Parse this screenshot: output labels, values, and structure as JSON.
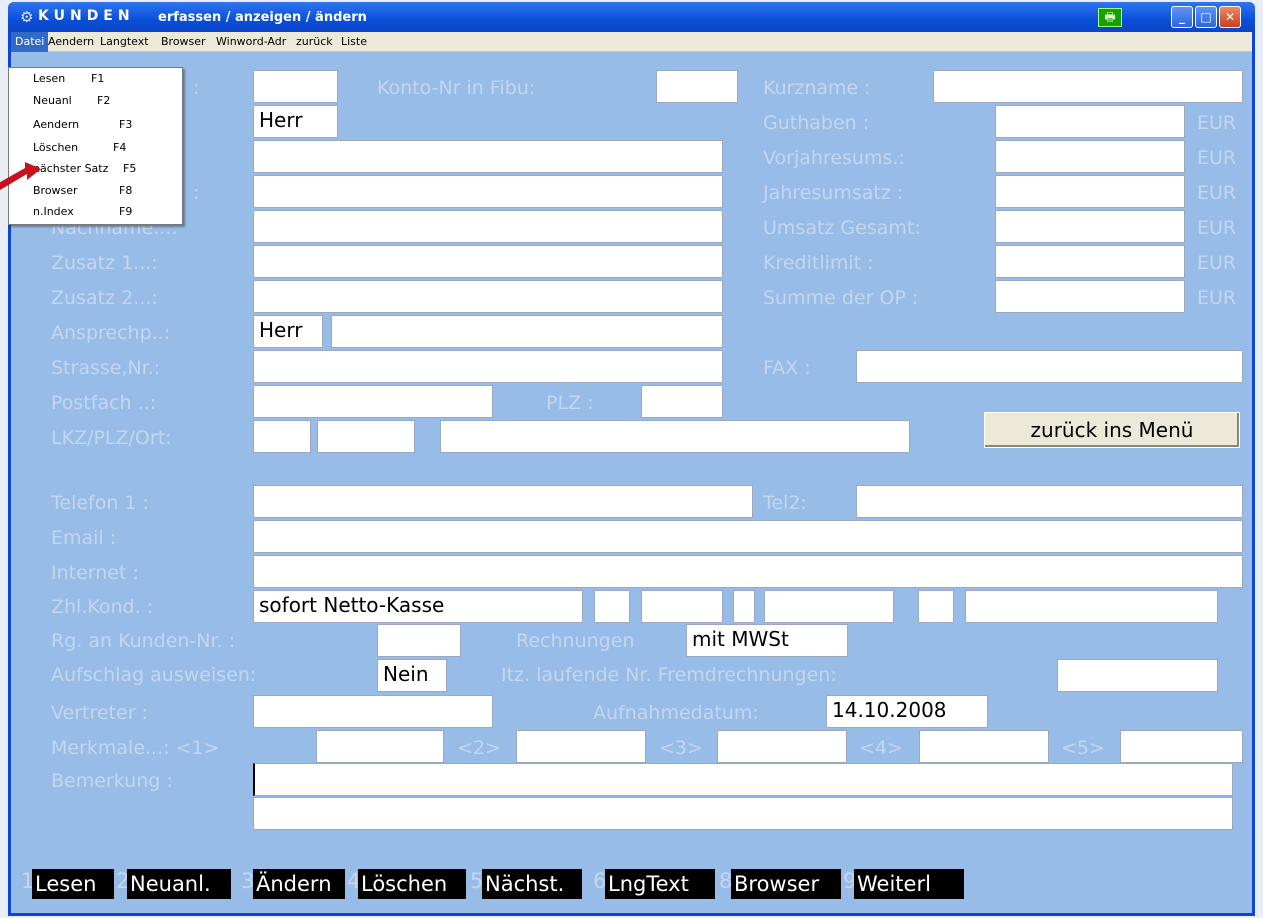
{
  "window": {
    "icon": "gear-icon",
    "title": "KUNDEN",
    "subtitle": "erfassen / anzeigen / ändern"
  },
  "menubar": [
    "Datei",
    "Aendern",
    "Langtext",
    "Browser",
    "Winword-Adr",
    "zurück",
    "Liste"
  ],
  "dropdown": [
    {
      "label": "Lesen",
      "key": "F1"
    },
    {
      "label": "Neuanl",
      "key": "F2"
    },
    {
      "label": "Aendern",
      "key": "F3"
    },
    {
      "label": "Löschen",
      "key": "F4"
    },
    {
      "label": "nächster Satz",
      "key": "F5"
    },
    {
      "label": "Browser",
      "key": "F8"
    },
    {
      "label": "n.Index",
      "key": "F9"
    }
  ],
  "labels": {
    "konto": "Konto-Nr in Fibu:",
    "kurzname": "Kurzname :",
    "guthaben": "Guthaben    :",
    "vorjahr": "Vorjahresums.:",
    "jahres": "Jahresumsatz :",
    "umsatz": "Umsatz Gesamt:",
    "kredit": "Kreditlimit  :",
    "summe": "Summe der OP :",
    "eur": "EUR",
    "colon_a": ":",
    "colon_b": ":",
    "name_frag": "Nachname...:",
    "zus1": "Zusatz 1...:",
    "zus2": "Zusatz 2...:",
    "ansp": "Ansprechp..:",
    "strasse": "Strasse,Nr.:",
    "postfach": "Postfach ..:",
    "plz": "PLZ :",
    "lkz": "LKZ/PLZ/Ort:",
    "fax": "FAX :",
    "tel1": "Telefon 1  :",
    "tel2": "Tel2:",
    "email": "Email    :",
    "internet": "Internet   :",
    "zhl": "Zhl.Kond.  :",
    "rg": "Rg. an Kunden-Nr.  :",
    "rechnungen": "Rechnungen",
    "aufschlag": "Aufschlag ausweisen:",
    "itz": "Itz. laufende Nr. Fremdrechnungen:",
    "vertreter": "Vertreter  :",
    "aufnahme": "Aufnahmedatum:",
    "merk": "Merkmale...: <1>",
    "m2": "<2>",
    "m3": "<3>",
    "m4": "<4>",
    "m5": "<5>",
    "bemerkung": "Bemerkung  :"
  },
  "values": {
    "anrede": "Herr",
    "ansp_anrede": "Herr",
    "zhl": "sofort Netto-Kasse",
    "rechnungen": "mit MWSt",
    "aufschlag": "Nein",
    "aufnahme": "14.10.2008"
  },
  "button": "zurück ins Menü",
  "fkeys": [
    {
      "num": "1",
      "label": "Lesen"
    },
    {
      "num": "2",
      "label": "Neuanl."
    },
    {
      "num": "3",
      "label": "Ändern"
    },
    {
      "num": "4",
      "label": "Löschen"
    },
    {
      "num": "5",
      "label": "Nächst."
    },
    {
      "num": "6",
      "label": "LngText"
    },
    {
      "num": "8",
      "label": "Browser"
    },
    {
      "num": "9",
      "label": "Weiterl"
    }
  ],
  "colors": {
    "form_bg": "#98bce8",
    "label": "#c4d6ee",
    "titlebar": "#0a4fd8",
    "arrow": "#c8101e"
  }
}
